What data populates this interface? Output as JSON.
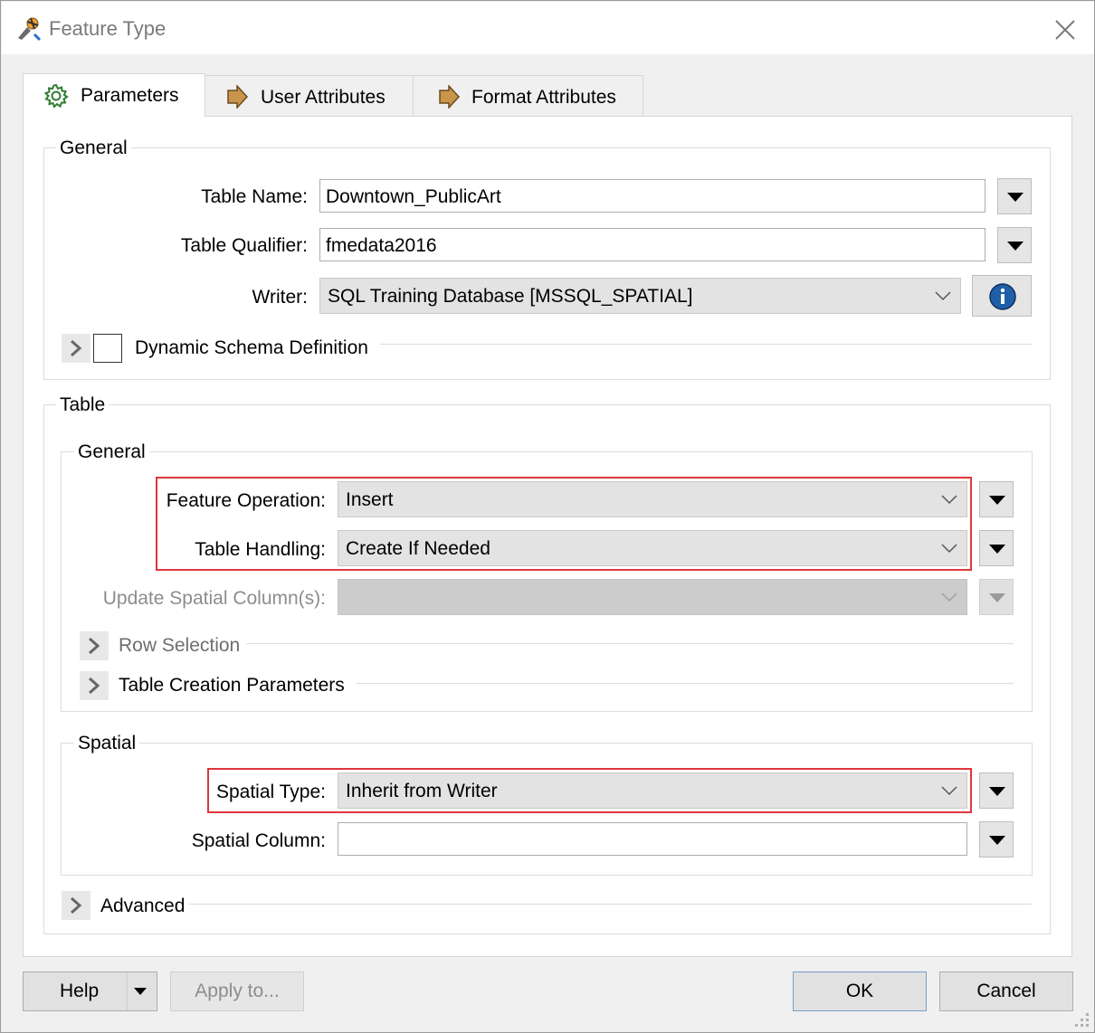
{
  "window": {
    "title": "Feature Type",
    "icons": {
      "app": "fme-workbench-icon",
      "close": "close-icon"
    }
  },
  "tabs": [
    {
      "label": "Parameters",
      "icon": "gear-icon",
      "active": true
    },
    {
      "label": "User Attributes",
      "icon": "arrow-right-icon",
      "active": false
    },
    {
      "label": "Format Attributes",
      "icon": "arrow-right-icon",
      "active": false
    }
  ],
  "general": {
    "title": "General",
    "table_name_label": "Table Name:",
    "table_name_value": "Downtown_PublicArt",
    "table_qualifier_label": "Table Qualifier:",
    "table_qualifier_value": "fmedata2016",
    "writer_label": "Writer:",
    "writer_value": "SQL Training Database [MSSQL_SPATIAL]",
    "dynamic_schema_label": "Dynamic Schema Definition",
    "dynamic_schema_checked": false
  },
  "table": {
    "title": "Table",
    "general": {
      "title": "General",
      "feature_operation_label": "Feature Operation:",
      "feature_operation_value": "Insert",
      "table_handling_label": "Table Handling:",
      "table_handling_value": "Create If Needed",
      "update_spatial_label": "Update Spatial Column(s):",
      "update_spatial_value": "",
      "row_selection_label": "Row Selection",
      "table_creation_label": "Table Creation Parameters"
    },
    "spatial": {
      "title": "Spatial",
      "spatial_type_label": "Spatial Type:",
      "spatial_type_value": "Inherit from Writer",
      "spatial_column_label": "Spatial Column:",
      "spatial_column_value": ""
    },
    "advanced_label": "Advanced"
  },
  "footer": {
    "help_label": "Help",
    "apply_label": "Apply to...",
    "ok_label": "OK",
    "cancel_label": "Cancel"
  },
  "colors": {
    "highlight": "#e0363c",
    "info": "#1f5fa8",
    "tab_arrow": "#c8954a"
  }
}
